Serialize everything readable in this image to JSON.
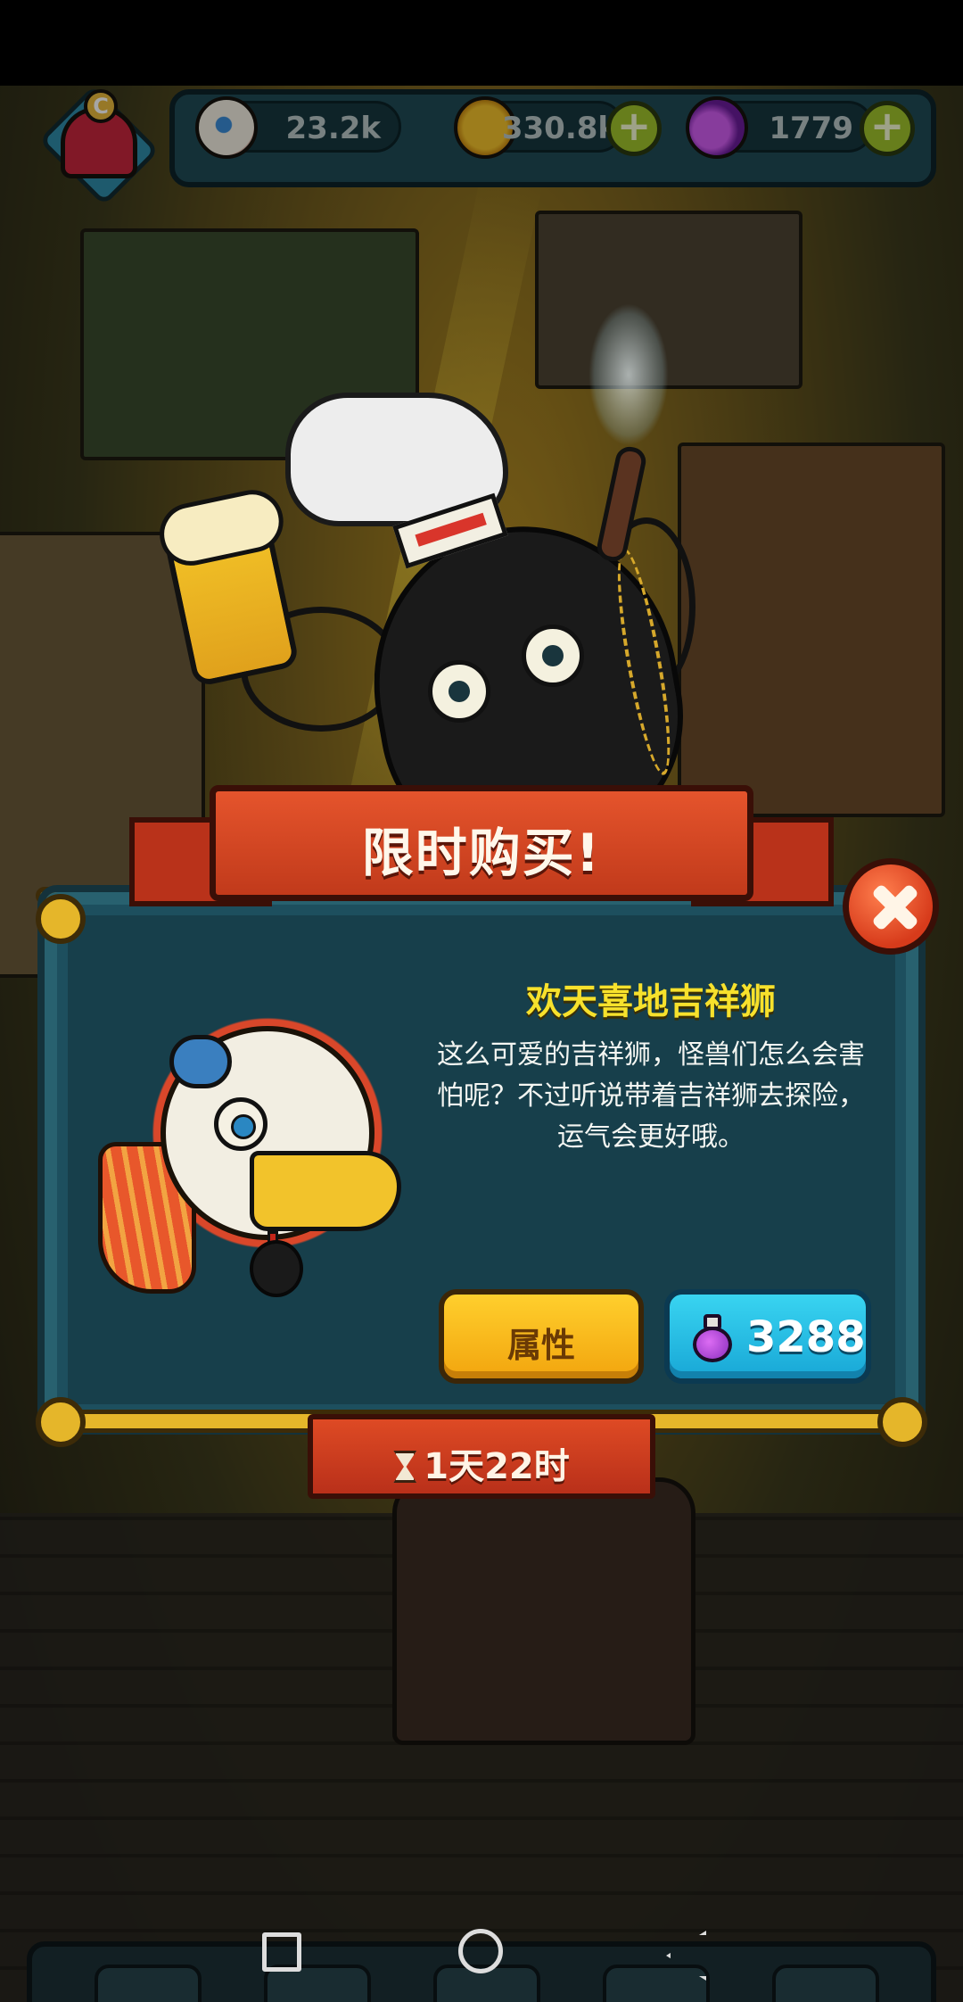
{
  "hud": {
    "resources": [
      {
        "icon": "eyeball-icon",
        "value": "23.2k"
      },
      {
        "icon": "gold-coin-icon",
        "value": "330.8k"
      },
      {
        "icon": "potion-icon",
        "value": "1779"
      }
    ]
  },
  "dialog": {
    "banner_title": "限时购买!",
    "item_title": "欢天喜地吉祥狮",
    "item_desc_lines": [
      "这么可爱的吉祥狮，怪兽们怎么会害",
      "怕呢？不过听说带着吉祥狮去探险，",
      "运气会更好哦。"
    ],
    "attributes_label": "属性",
    "price": "3288",
    "timer": "1天22时"
  },
  "colors": {
    "accent_gold": "#e5b62a",
    "banner_red": "#d14323",
    "panel_teal": "#1d4f5e",
    "buy_blue": "#23b9e3",
    "title_yellow": "#f7e12c"
  }
}
